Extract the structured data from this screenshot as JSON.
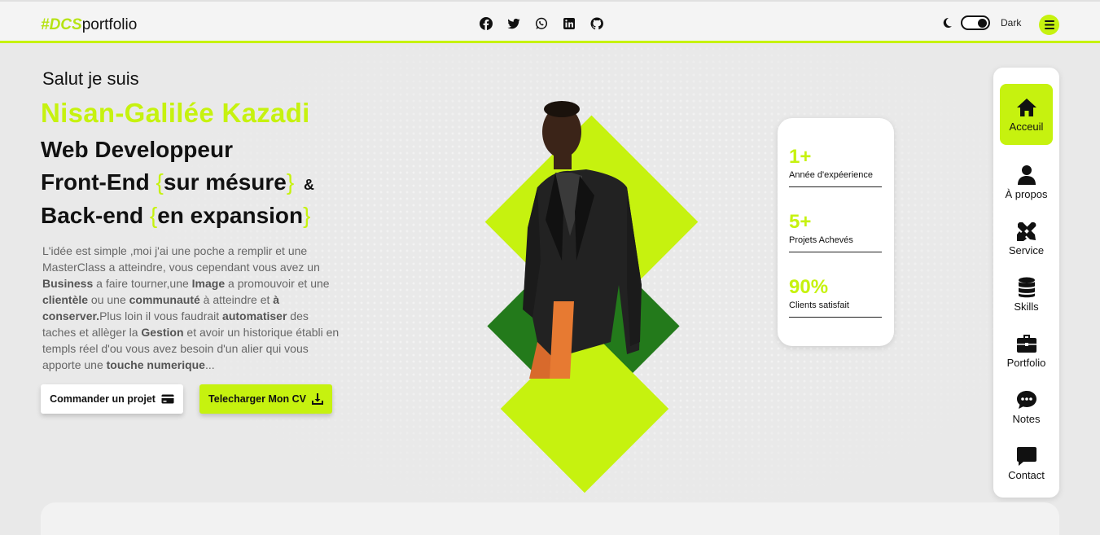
{
  "header": {
    "logo_hash": "#DCS",
    "logo_rest": "portfolio",
    "socials": [
      "facebook-icon",
      "twitter-icon",
      "whatsapp-icon",
      "linkedin-icon",
      "github-icon"
    ],
    "theme_label": "Dark"
  },
  "hero": {
    "greeting": "Salut je suis",
    "name": "Nisan-Galilée Kazadi",
    "role_line1": "Web Developpeur",
    "role_line2_pre": "Front-End ",
    "role_line2_brace_open": "{",
    "role_line2_mid": "sur mésure",
    "role_line2_brace_close": "}",
    "role_line2_amp": "&",
    "role_line3_pre": "Back-end ",
    "role_line3_brace_open": "{",
    "role_line3_mid": "en expansion",
    "role_line3_brace_close": "}",
    "desc": {
      "t1": "L'idée est simple ,moi j'ai une poche a remplir et une MasterClass a atteindre, vous cependant vous avez un ",
      "b1": "Business",
      "t2": " a faire tourner,une ",
      "b2": "Image",
      "t3": " a promouvoir et une ",
      "b3": "clientèle",
      "t4": " ou une ",
      "b4": "communauté",
      "t5": " à atteindre et ",
      "b5": "à conserver.",
      "t6": "Plus loin il vous faudrait ",
      "b6": "automatiser",
      "t7": " des taches et allèger la ",
      "b7": "Gestion",
      "t8": " et avoir un historique établi en templs réel d'ou vous avez besoin d'un alier qui vous apporte une ",
      "b8": "touche numerique",
      "t9": "..."
    },
    "btn_order": "Commander un projet",
    "btn_cv": "Telecharger Mon CV"
  },
  "stats": [
    {
      "num": "1+",
      "label": "Année d'expéerience"
    },
    {
      "num": "5+",
      "label": "Projets Achevés"
    },
    {
      "num": "90%",
      "label": "Clients satisfait"
    }
  ],
  "nav": [
    {
      "label": "Acceuil",
      "icon": "home-icon",
      "active": true
    },
    {
      "label": "À propos",
      "icon": "user-icon"
    },
    {
      "label": "Service",
      "icon": "tools-icon"
    },
    {
      "label": "Skills",
      "icon": "database-icon"
    },
    {
      "label": "Portfolio",
      "icon": "briefcase-icon"
    },
    {
      "label": "Notes",
      "icon": "comment-dots-icon"
    },
    {
      "label": "Contact",
      "icon": "message-icon"
    }
  ],
  "colors": {
    "accent": "#c6f20f",
    "dark_green": "#237a1b",
    "background": "#e9e9e9"
  }
}
